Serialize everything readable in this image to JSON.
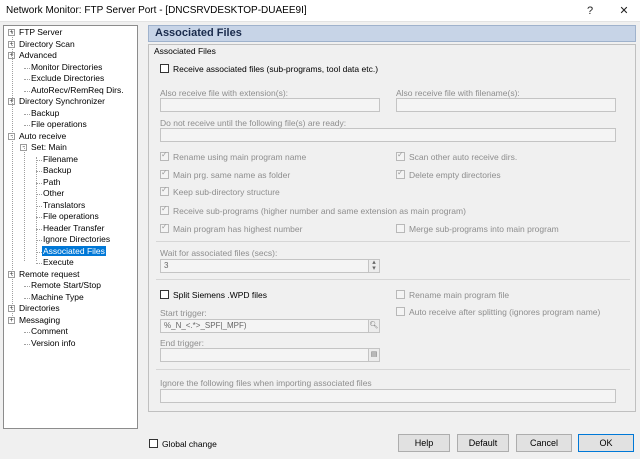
{
  "window": {
    "title": "Network Monitor: FTP Server Port - [DNCSRVDESKTOP-DUAEE9I]",
    "help_glyph": "?",
    "close_glyph": "✕"
  },
  "tree": {
    "items": [
      {
        "label": "FTP Server",
        "expander": "+"
      },
      {
        "label": "Directory Scan",
        "expander": "+"
      },
      {
        "label": "Advanced",
        "expander": "+"
      },
      {
        "label": "Monitor Directories",
        "expander": ""
      },
      {
        "label": "Exclude Directories",
        "expander": ""
      },
      {
        "label": "AutoRecv/RemReq Dirs.",
        "expander": ""
      },
      {
        "label": "Directory Synchronizer",
        "expander": "+"
      },
      {
        "label": "Backup",
        "expander": ""
      },
      {
        "label": "File operations",
        "expander": ""
      },
      {
        "label": "Auto receive",
        "expander": "-"
      },
      {
        "label": "Set: Main",
        "expander": "-"
      },
      {
        "label": "Filename",
        "expander": ""
      },
      {
        "label": "Backup",
        "expander": ""
      },
      {
        "label": "Path",
        "expander": ""
      },
      {
        "label": "Other",
        "expander": ""
      },
      {
        "label": "Translators",
        "expander": ""
      },
      {
        "label": "File operations",
        "expander": ""
      },
      {
        "label": "Header Transfer",
        "expander": ""
      },
      {
        "label": "Ignore Directories",
        "expander": ""
      },
      {
        "label": "Associated Files",
        "expander": ""
      },
      {
        "label": "Execute",
        "expander": ""
      },
      {
        "label": "Remote request",
        "expander": "+"
      },
      {
        "label": "Remote Start/Stop",
        "expander": ""
      },
      {
        "label": "Machine Type",
        "expander": ""
      },
      {
        "label": "Directories",
        "expander": "+"
      },
      {
        "label": "Messaging",
        "expander": "+"
      },
      {
        "label": "Comment",
        "expander": ""
      },
      {
        "label": "Version info",
        "expander": ""
      }
    ],
    "selected": "Associated Files"
  },
  "panel": {
    "header": "Associated Files",
    "group_title": "Associated Files",
    "receive_associated": {
      "label": "Receive associated files (sub-programs, tool data etc.)",
      "checked": false
    },
    "ext_label": "Also receive file with extension(s):",
    "ext_value": "",
    "filename_label": "Also receive file with filename(s):",
    "filename_value": "",
    "ready_label": "Do not receive until the following file(s) are ready:",
    "ready_value": "",
    "options": {
      "rename_main": {
        "label": "Rename using main program name",
        "checked": true
      },
      "scan_other": {
        "label": "Scan other auto receive dirs.",
        "checked": true
      },
      "main_prg_folder": {
        "label": "Main prg. same name as folder",
        "checked": true
      },
      "delete_empty": {
        "label": "Delete empty directories",
        "checked": true
      },
      "keep_subdir": {
        "label": "Keep sub-directory structure",
        "checked": true
      },
      "receive_sub": {
        "label": "Receive sub-programs (higher number and same extension as main program)",
        "checked": true
      },
      "main_highest": {
        "label": "Main program has highest number",
        "checked": true
      },
      "merge_sub": {
        "label": "Merge sub-programs into main program",
        "checked": false
      }
    },
    "wait_label": "Wait for associated files (secs):",
    "wait_value": "3",
    "split": {
      "label": "Split Siemens .WPD files",
      "checked": false,
      "rename_main": {
        "label": "Rename main program file",
        "checked": false
      },
      "auto_receive": {
        "label": "Auto receive after splitting (ignores program name)",
        "checked": false
      },
      "start_label": "Start trigger:",
      "start_value": "%_N_<.*>_SPF|_MPF)",
      "end_label": "End trigger:",
      "end_value": ""
    },
    "ignore_label": "Ignore the following files when importing associated files",
    "ignore_value": ""
  },
  "footer": {
    "global_change": {
      "label": "Global change",
      "checked": false
    },
    "help": "Help",
    "default": "Default",
    "cancel": "Cancel",
    "ok": "OK"
  }
}
